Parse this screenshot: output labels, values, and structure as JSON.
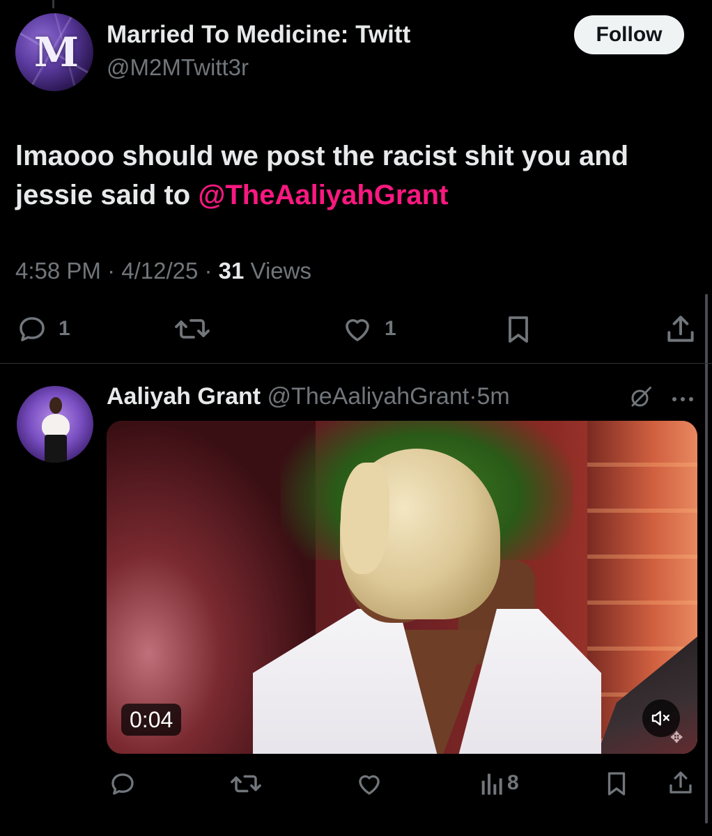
{
  "tweet": {
    "author_name": "Married To Medicine: Twitt",
    "author_handle": "@M2MTwitt3r",
    "avatar_letters": "M",
    "follow_label": "Follow",
    "text_before": "lmaooo should we post the racist shit you and jessie said to ",
    "mention": "@TheAaliyahGrant",
    "time": "4:58 PM",
    "sep1": " · ",
    "date": "4/12/25",
    "sep2": " · ",
    "views_count": "31",
    "views_label": " Views",
    "replies": "1",
    "likes": "1"
  },
  "reply_tweet": {
    "author_name": "Aaliyah Grant",
    "author_handle": "@TheAaliyahGrant",
    "sep": "·",
    "age": "5m",
    "video_time": "0:04",
    "views": "8"
  },
  "colors": {
    "background": "#000000",
    "text": "#e7e9ea",
    "muted": "#71767b",
    "mention": "#f91880",
    "follow_bg": "#eff3f4"
  },
  "icons": {
    "reply": "reply-icon",
    "retweet": "retweet-icon",
    "like": "heart-icon",
    "bookmark": "bookmark-icon",
    "share": "share-icon",
    "views": "analytics-icon",
    "grok": "grok-icon",
    "more": "more-icon",
    "mute": "mute-icon"
  }
}
